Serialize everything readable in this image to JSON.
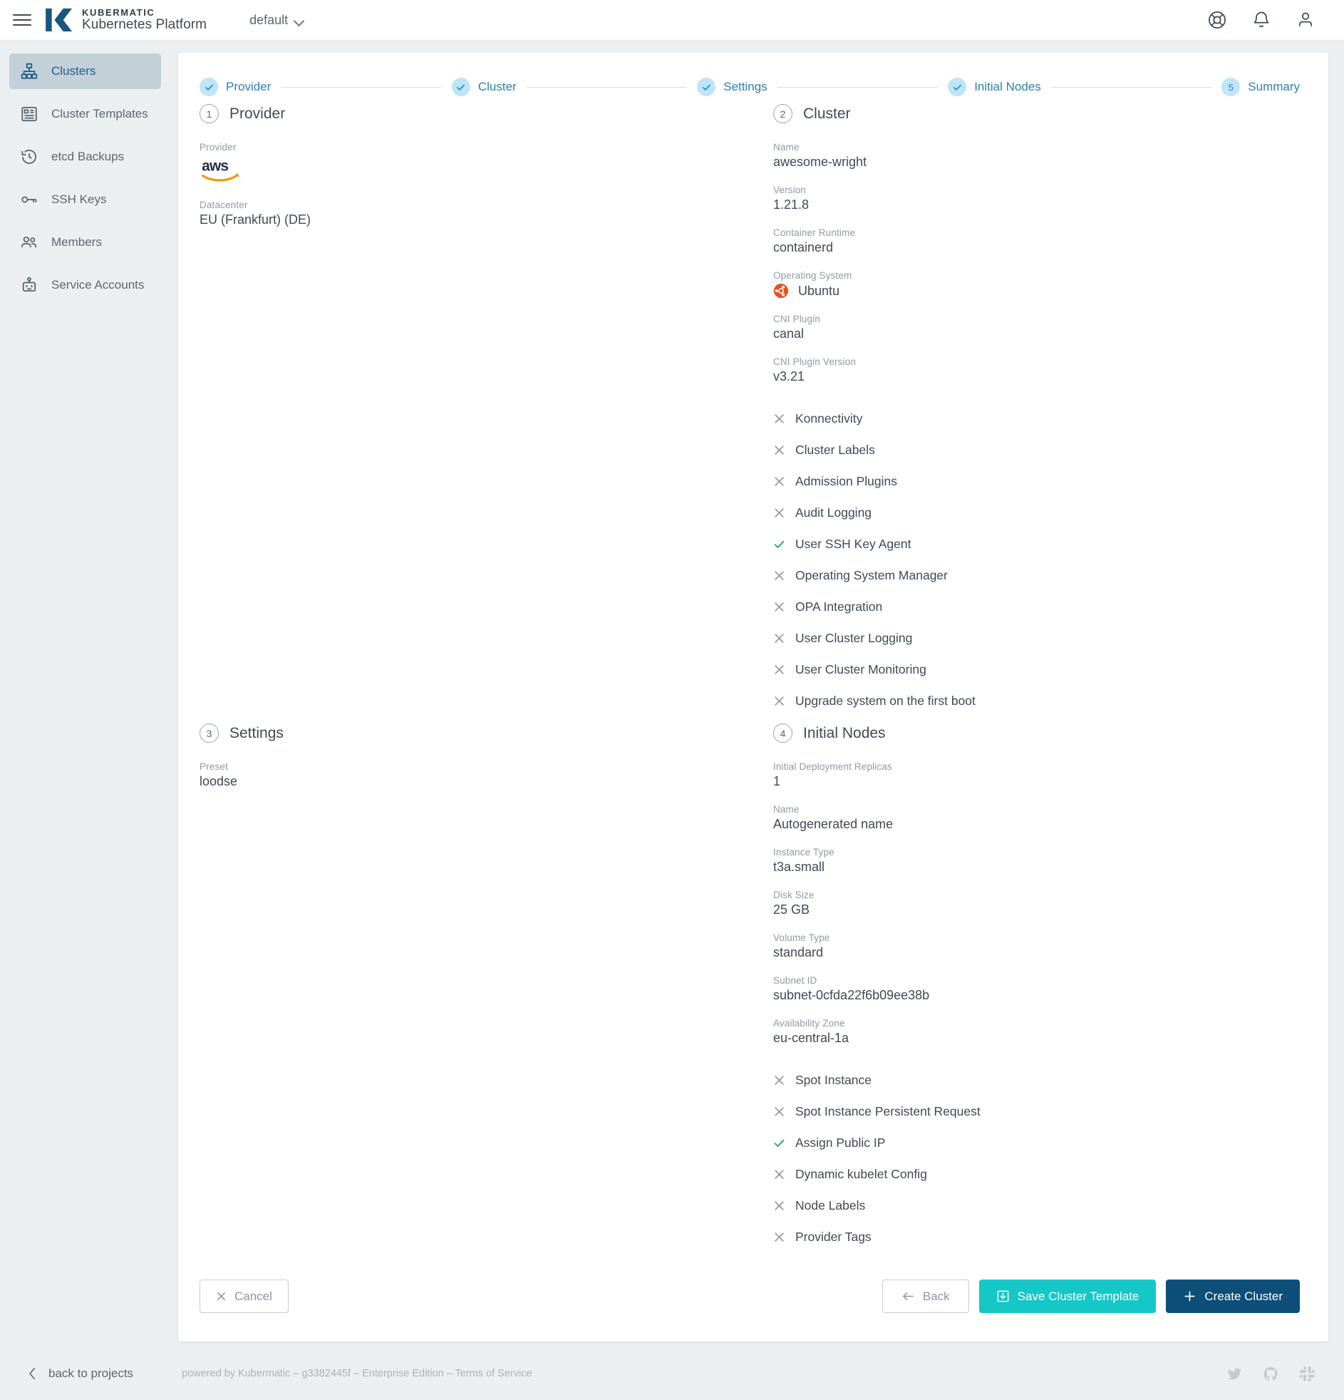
{
  "topbar": {
    "menu_icon": "hamburger-menu-icon",
    "brand_line1": "KUBERMATIC",
    "brand_line2": "Kubernetes Platform",
    "project_selector": "default",
    "icons": [
      "help-icon",
      "notifications-bell-icon",
      "user-account-icon"
    ]
  },
  "sidebar": {
    "items": [
      {
        "label": "Clusters",
        "icon": "clusters-icon",
        "active": true
      },
      {
        "label": "Cluster Templates",
        "icon": "cluster-templates-icon",
        "active": false
      },
      {
        "label": "etcd Backups",
        "icon": "etcd-backups-icon",
        "active": false
      },
      {
        "label": "SSH Keys",
        "icon": "ssh-keys-icon",
        "active": false
      },
      {
        "label": "Members",
        "icon": "members-icon",
        "active": false
      },
      {
        "label": "Service Accounts",
        "icon": "service-accounts-icon",
        "active": false
      }
    ]
  },
  "stepper": {
    "steps": [
      {
        "label": "Provider",
        "state": "done",
        "number": "1"
      },
      {
        "label": "Cluster",
        "state": "done",
        "number": "2"
      },
      {
        "label": "Settings",
        "state": "done",
        "number": "3"
      },
      {
        "label": "Initial Nodes",
        "state": "done",
        "number": "4"
      },
      {
        "label": "Summary",
        "state": "current",
        "number": "5"
      }
    ]
  },
  "provider_section": {
    "number": "1",
    "title": "Provider",
    "fields": [
      {
        "label": "Provider",
        "value": "aws",
        "type": "logo"
      },
      {
        "label": "Datacenter",
        "value": "EU (Frankfurt) (DE)",
        "type": "text"
      }
    ]
  },
  "cluster_section": {
    "number": "2",
    "title": "Cluster",
    "fields": [
      {
        "label": "Name",
        "value": "awesome-wright",
        "type": "text"
      },
      {
        "label": "Version",
        "value": "1.21.8",
        "type": "text"
      },
      {
        "label": "Container Runtime",
        "value": "containerd",
        "type": "text"
      },
      {
        "label": "Operating System",
        "value": "Ubuntu",
        "type": "os",
        "icon": "ubuntu-icon"
      },
      {
        "label": "CNI Plugin",
        "value": "canal",
        "type": "text"
      },
      {
        "label": "CNI Plugin Version",
        "value": "v3.21",
        "type": "text"
      }
    ],
    "flags": [
      {
        "label": "Konnectivity",
        "enabled": false
      },
      {
        "label": "Cluster Labels",
        "enabled": false
      },
      {
        "label": "Admission Plugins",
        "enabled": false
      },
      {
        "label": "Audit Logging",
        "enabled": false
      },
      {
        "label": "User SSH Key Agent",
        "enabled": true
      },
      {
        "label": "Operating System Manager",
        "enabled": false
      },
      {
        "label": "OPA Integration",
        "enabled": false
      },
      {
        "label": "User Cluster Logging",
        "enabled": false
      },
      {
        "label": "User Cluster Monitoring",
        "enabled": false
      },
      {
        "label": "Upgrade system on the first boot",
        "enabled": false
      }
    ]
  },
  "settings_section": {
    "number": "3",
    "title": "Settings",
    "fields": [
      {
        "label": "Preset",
        "value": "loodse",
        "type": "text"
      }
    ]
  },
  "initial_nodes_section": {
    "number": "4",
    "title": "Initial Nodes",
    "fields": [
      {
        "label": "Initial Deployment Replicas",
        "value": "1",
        "type": "text"
      },
      {
        "label": "Name",
        "value": "Autogenerated name",
        "type": "text"
      },
      {
        "label": "Instance Type",
        "value": "t3a.small",
        "type": "text"
      },
      {
        "label": "Disk Size",
        "value": "25 GB",
        "type": "text"
      },
      {
        "label": "Volume Type",
        "value": "standard",
        "type": "text"
      },
      {
        "label": "Subnet ID",
        "value": "subnet-0cfda22f6b09ee38b",
        "type": "text"
      },
      {
        "label": "Availability Zone",
        "value": "eu-central-1a",
        "type": "text"
      }
    ],
    "flags": [
      {
        "label": "Spot Instance",
        "enabled": false
      },
      {
        "label": "Spot Instance Persistent Request",
        "enabled": false
      },
      {
        "label": "Assign Public IP",
        "enabled": true
      },
      {
        "label": "Dynamic kubelet Config",
        "enabled": false
      },
      {
        "label": "Node Labels",
        "enabled": false
      },
      {
        "label": "Provider Tags",
        "enabled": false
      }
    ]
  },
  "actions": {
    "cancel": "Cancel",
    "back": "Back",
    "save_template": "Save Cluster Template",
    "create_cluster": "Create Cluster"
  },
  "footer": {
    "back_to_projects": "back to projects",
    "powered_by": "powered by Kubermatic",
    "dash1": "–",
    "build": "g3382445f",
    "dash2": "–",
    "edition": "Enterprise Edition",
    "dash3": "–",
    "terms": "Terms of Service",
    "social": [
      "twitter-icon",
      "github-icon",
      "slack-icon"
    ]
  },
  "colors": {
    "accent_teal": "#16c7c7",
    "accent_navy": "#0d4f78",
    "step_blue": "#2b7fad",
    "step_bubble": "#bfe5f8",
    "enabled_green": "#2aab5a",
    "disabled_gray": "#8d959c",
    "sidebar_active_bg": "#c3d0d8",
    "ubuntu_orange": "#e8501e",
    "aws_orange": "#f79400"
  }
}
